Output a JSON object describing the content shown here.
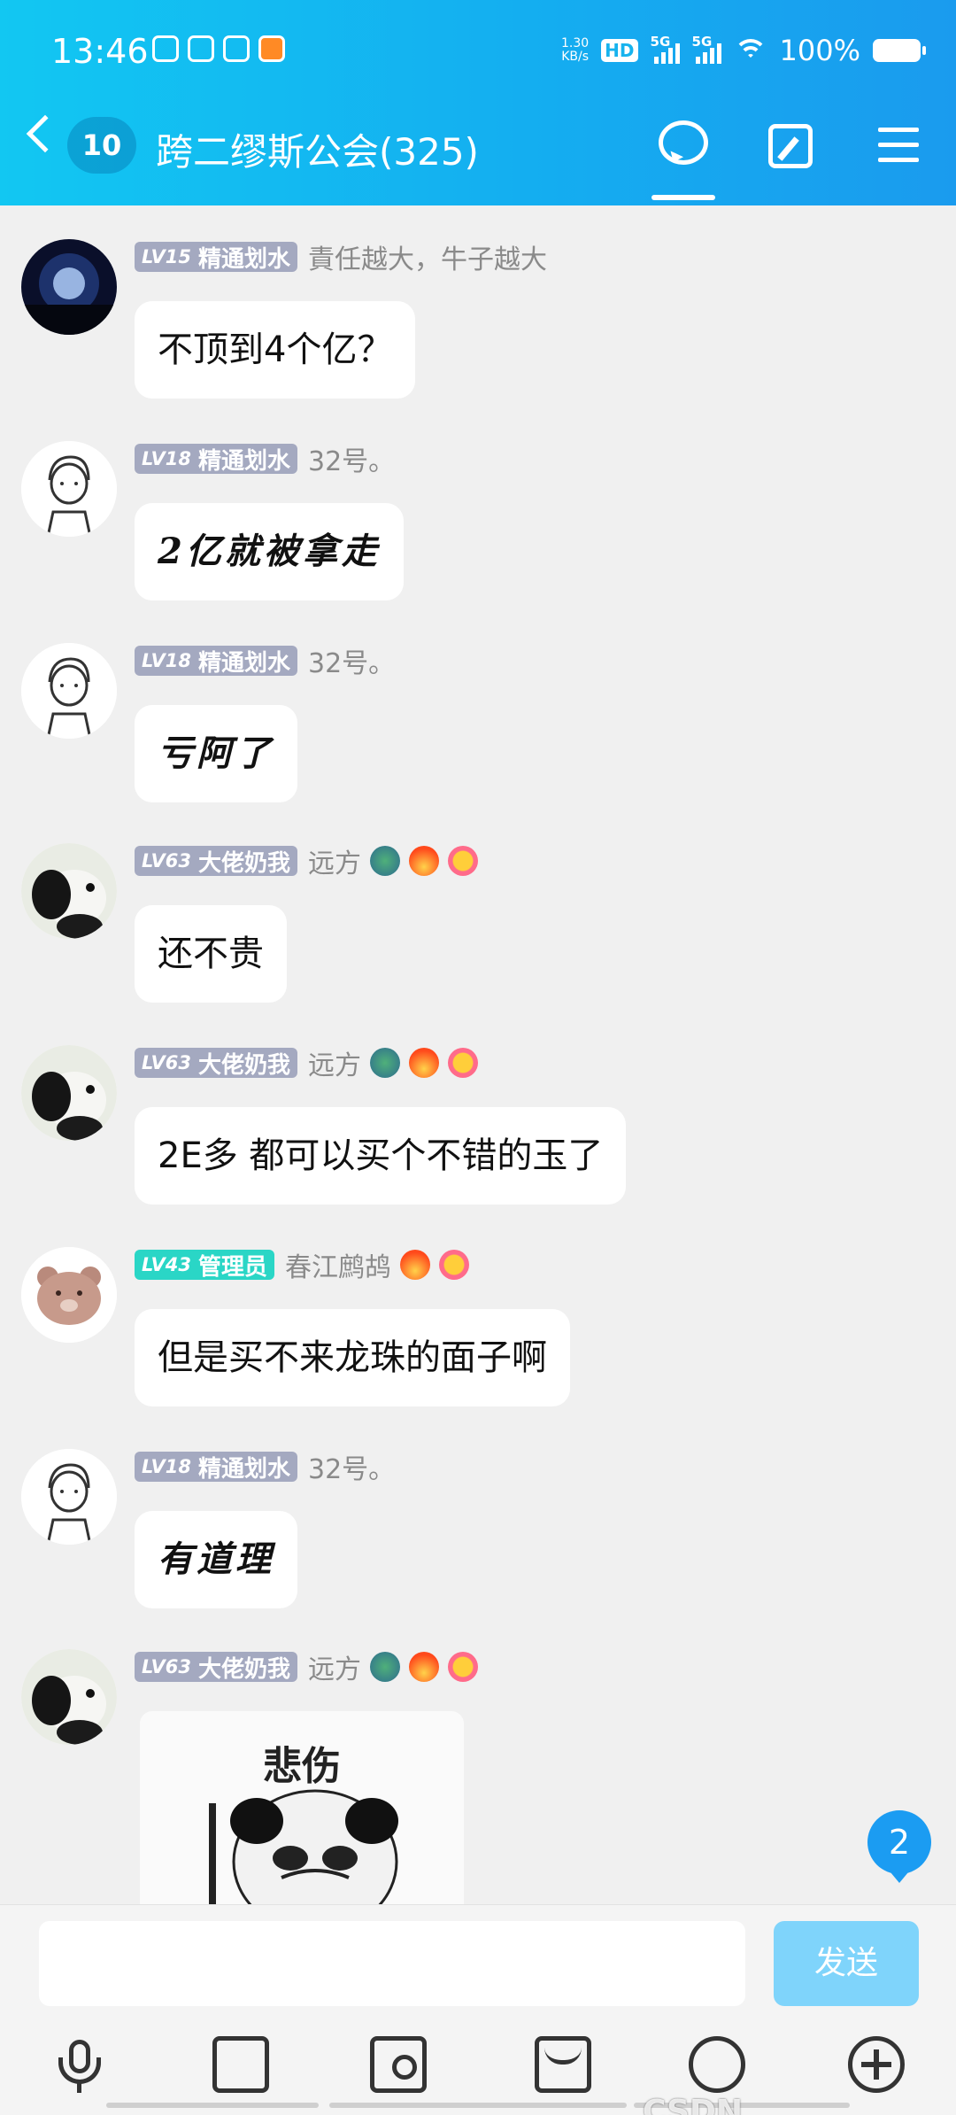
{
  "status": {
    "time": "13:46",
    "net_speed_value": "1.30",
    "net_speed_unit": "KB/s",
    "hd": "HD",
    "sim1": "5G",
    "sim2": "5G",
    "battery": "100%"
  },
  "header": {
    "unread": "10",
    "title": "跨二缪斯公会(325)"
  },
  "messages": [
    {
      "level": "LV15",
      "role": "精通划水",
      "nick": "責任越大，牛子越大",
      "text": "不顶到4个亿？",
      "style": "normal"
    },
    {
      "level": "LV18",
      "role": "精通划水",
      "nick": "32号。",
      "text": "2亿就被拿走",
      "style": "hand"
    },
    {
      "level": "LV18",
      "role": "精通划水",
      "nick": "32号。",
      "text": "亏阿了",
      "style": "hand"
    },
    {
      "level": "LV63",
      "role": "大佬奶我",
      "nick": "远方",
      "text": "还不贵",
      "style": "normal"
    },
    {
      "level": "LV63",
      "role": "大佬奶我",
      "nick": "远方",
      "text": "2E多 都可以买个不错的玉了",
      "style": "normal"
    },
    {
      "level": "LV43",
      "role": "管理员",
      "nick": "春江鹧鸪",
      "text": "但是买不来龙珠的面子啊",
      "style": "normal"
    },
    {
      "level": "LV18",
      "role": "精通划水",
      "nick": "32号。",
      "text": "有道理",
      "style": "hand"
    },
    {
      "level": "LV63",
      "role": "大佬奶我",
      "nick": "远方",
      "sticker_text": "悲伤"
    }
  ],
  "new_message_count": "2",
  "input": {
    "placeholder": "",
    "send_label": "发送"
  },
  "watermark": "CSDN @opomkiop",
  "icons": {
    "back": "chevron-left-icon",
    "chat": "chat-bubble-icon",
    "edit": "edit-icon",
    "menu": "menu-icon",
    "toolbar": [
      "microphone-icon",
      "image-icon",
      "camera-icon",
      "red-packet-icon",
      "emoji-icon",
      "plus-icon"
    ]
  },
  "colors": {
    "header_start": "#12c7f2",
    "header_end": "#1a9bee",
    "level_badge": "#a4a9c0",
    "admin_badge": "#2ad6c6",
    "send_button": "#7fd4fb",
    "new_count_badge": "#1b9cf2"
  }
}
